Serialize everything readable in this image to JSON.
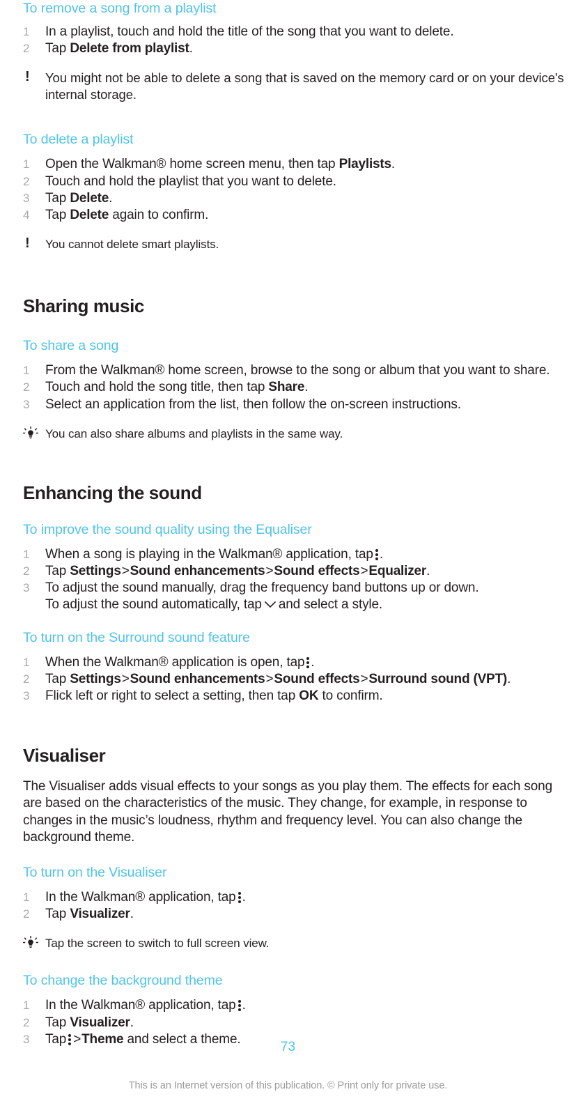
{
  "document": {
    "page_number": "73",
    "footer_note": "This is an Internet version of this publication. © Print only for private use.",
    "accent_color": "#4ec3e8",
    "text_color": "#231f20",
    "muted_color": "#a7a9ac"
  },
  "icons": {
    "warning": "exclamation-mark",
    "tip": "lightbulb",
    "menu": "kebab-menu-three-dots",
    "dropdown": "chevron-down"
  },
  "sections": {
    "remove_song": {
      "heading": "To remove a song from a playlist",
      "steps": [
        {
          "num": "1",
          "pre": "In a playlist, touch and hold the title of the song that you want to delete.",
          "bold": "",
          "post": ""
        },
        {
          "num": "2",
          "pre": "Tap ",
          "bold": "Delete from playlist",
          "post": "."
        }
      ],
      "note": "You might not be able to delete a song that is saved on the memory card or on your device's internal storage."
    },
    "delete_playlist": {
      "heading": "To delete a playlist",
      "steps": [
        {
          "num": "1",
          "pre": "Open the Walkman® home screen menu, then tap ",
          "bold": "Playlists",
          "post": "."
        },
        {
          "num": "2",
          "pre": "Touch and hold the playlist that you want to delete.",
          "bold": "",
          "post": ""
        },
        {
          "num": "3",
          "pre": "Tap ",
          "bold": "Delete",
          "post": "."
        },
        {
          "num": "4",
          "pre": "Tap ",
          "bold": "Delete",
          "post": " again to confirm."
        }
      ],
      "note": "You cannot delete smart playlists."
    },
    "sharing_music": {
      "heading": "Sharing music",
      "sub": {
        "heading": "To share a song",
        "steps": [
          {
            "num": "1",
            "pre": "From the Walkman® home screen, browse to the song or album that you want to share.",
            "bold": "",
            "post": ""
          },
          {
            "num": "2",
            "pre": "Touch and hold the song title, then tap ",
            "bold": "Share",
            "post": "."
          },
          {
            "num": "3",
            "pre": "Select an application from the list, then follow the on-screen instructions.",
            "bold": "",
            "post": ""
          }
        ],
        "tip": "You can also share albums and playlists in the same way."
      }
    },
    "enhancing_sound": {
      "heading": "Enhancing the sound",
      "equaliser": {
        "heading": "To improve the sound quality using the Equaliser",
        "step1_pre": "When a song is playing in the Walkman® application, tap",
        "step1_post": ".",
        "step2_pre": "Tap ",
        "step2_b1": "Settings",
        "step2_b2": "Sound enhancements",
        "step2_b3": "Sound effects",
        "step2_b4": "Equalizer",
        "step2_post": ".",
        "step3_line1": "To adjust the sound manually, drag the frequency band buttons up or down.",
        "step3_line2_pre": "To adjust the sound automatically, tap",
        "step3_line2_post": "and select a style."
      },
      "surround": {
        "heading": "To turn on the Surround sound feature",
        "step1_pre": "When the Walkman® application is open, tap",
        "step1_post": ".",
        "step2_pre": "Tap ",
        "step2_b1": "Settings",
        "step2_b2": "Sound enhancements",
        "step2_b3": "Sound effects",
        "step2_b4": "Surround sound (VPT)",
        "step2_post": ".",
        "step3_pre": "Flick left or right to select a setting, then tap ",
        "step3_bold": "OK",
        "step3_post": " to confirm."
      }
    },
    "visualiser": {
      "heading": "Visualiser",
      "intro": "The Visualiser adds visual effects to your songs as you play them. The effects for each song are based on the characteristics of the music. They change, for example, in response to changes in the music’s loudness, rhythm and frequency level. You can also change the background theme.",
      "turn_on": {
        "heading": "To turn on the Visualiser",
        "step1_pre": "In the Walkman® application, tap",
        "step1_post": ".",
        "step2_pre": "Tap ",
        "step2_bold": "Visualizer",
        "step2_post": ".",
        "tip": "Tap the screen to switch to full screen view."
      },
      "change_theme": {
        "heading": "To change the background theme",
        "step1_pre": "In the Walkman® application, tap",
        "step1_post": ".",
        "step2_pre": "Tap ",
        "step2_bold": "Visualizer",
        "step2_post": ".",
        "step3_pre": "Tap",
        "step3_gt": ">",
        "step3_bold": "Theme",
        "step3_post": " and select a theme."
      }
    }
  },
  "separators": {
    "gt": ">"
  }
}
